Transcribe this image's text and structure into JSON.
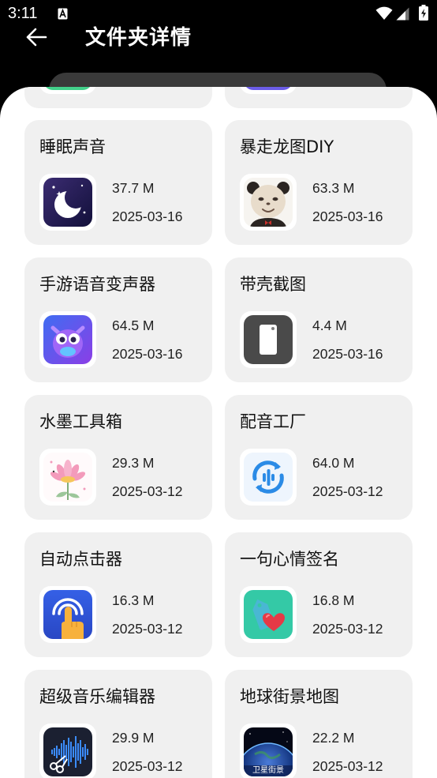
{
  "status_bar": {
    "time": "3:11",
    "icons": [
      "a-notification-icon",
      "wifi-icon",
      "signal-icon",
      "battery-charging-icon"
    ]
  },
  "header": {
    "back_icon": "back-arrow-icon",
    "title": "文件夹详情"
  },
  "colors": {
    "background": "#000000",
    "sheet": "#ffffff",
    "card": "#f0f0f0",
    "text": "#111111"
  },
  "partial_apps": [
    {
      "icon": "green-app-icon"
    },
    {
      "icon": "purple-app-icon"
    }
  ],
  "apps": [
    {
      "name": "睡眠声音",
      "size": "37.7 M",
      "date": "2025-03-16",
      "icon": "moon-sleep-icon"
    },
    {
      "name": "暴走龙图DIY",
      "size": "63.3 M",
      "date": "2025-03-16",
      "icon": "panda-meme-icon"
    },
    {
      "name": "手游语音变声器",
      "size": "64.5 M",
      "date": "2025-03-16",
      "icon": "purple-monster-icon"
    },
    {
      "name": "带壳截图",
      "size": "4.4 M",
      "date": "2025-03-16",
      "icon": "phone-frame-icon"
    },
    {
      "name": "水墨工具箱",
      "size": "29.3 M",
      "date": "2025-03-12",
      "icon": "lotus-flower-icon"
    },
    {
      "name": "配音工厂",
      "size": "64.0 M",
      "date": "2025-03-12",
      "icon": "dubbing-wave-icon"
    },
    {
      "name": "自动点击器",
      "size": "16.3 M",
      "date": "2025-03-12",
      "icon": "tapping-finger-icon"
    },
    {
      "name": "一句心情签名",
      "size": "16.8 M",
      "date": "2025-03-12",
      "icon": "heart-tag-icon"
    },
    {
      "name": "超级音乐编辑器",
      "size": "29.9 M",
      "date": "2025-03-12",
      "icon": "waveform-scissors-icon"
    },
    {
      "name": "地球街景地图",
      "size": "22.2 M",
      "date": "2025-03-12",
      "icon": "earth-street-view-icon",
      "icon_text": "卫星街景"
    }
  ]
}
